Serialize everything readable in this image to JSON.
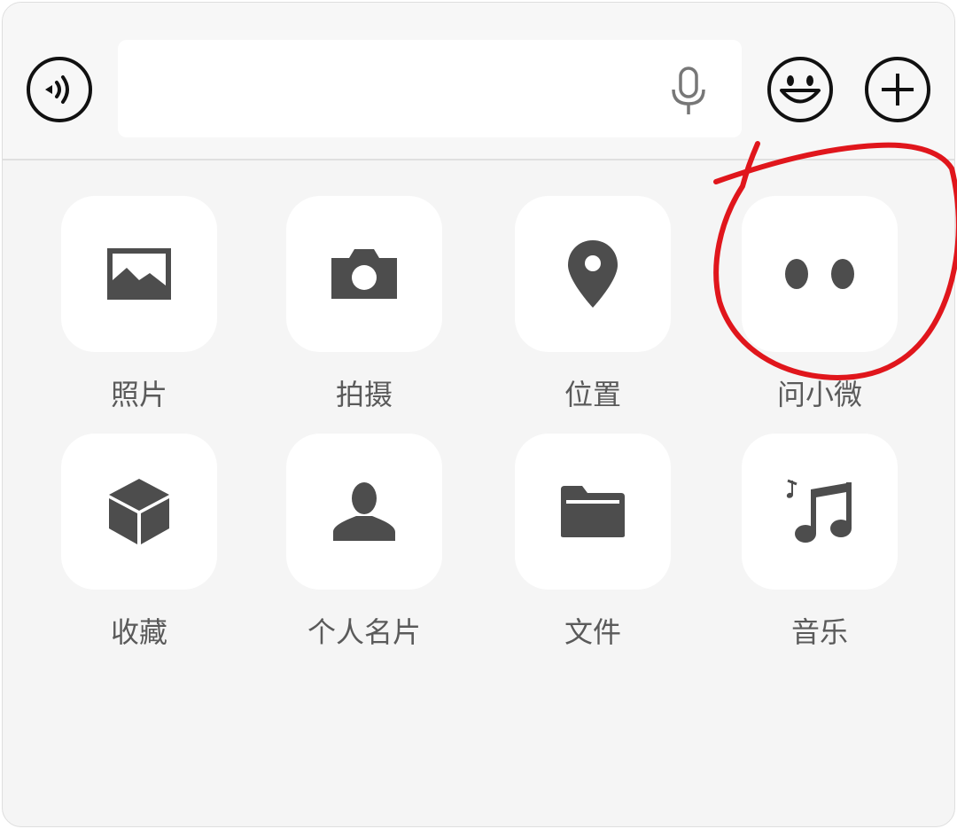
{
  "input_bar": {
    "text_value": "",
    "voice_icon": "voice-wave-icon",
    "mic_icon": "microphone-icon",
    "emoji_icon": "smiley-face-icon",
    "plus_icon": "plus-circle-icon"
  },
  "actions": [
    {
      "label": "照片",
      "icon": "photo-icon"
    },
    {
      "label": "拍摄",
      "icon": "camera-icon"
    },
    {
      "label": "位置",
      "icon": "location-pin-icon"
    },
    {
      "label": "问小微",
      "icon": "two-dots-icon"
    },
    {
      "label": "收藏",
      "icon": "cube-icon"
    },
    {
      "label": "个人名片",
      "icon": "person-icon"
    },
    {
      "label": "文件",
      "icon": "folder-icon"
    },
    {
      "label": "音乐",
      "icon": "music-note-icon"
    }
  ],
  "colors": {
    "panel_bg": "#f5f5f5",
    "icon": "#4d4d4d",
    "label": "#5a5a5a",
    "annotation": "#e0161c"
  }
}
